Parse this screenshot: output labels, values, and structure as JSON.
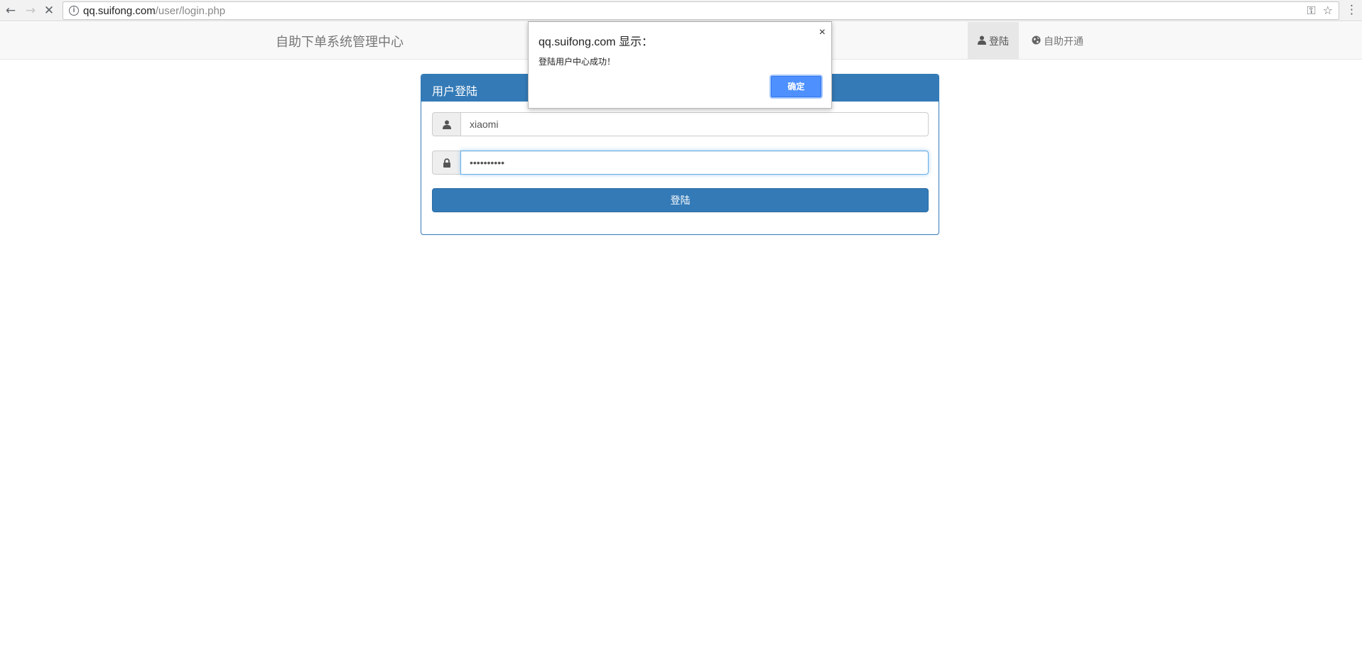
{
  "browser": {
    "url_host": "qq.suifong.com",
    "url_path": "/user/login.php",
    "back_icon": "←",
    "forward_icon": "→",
    "stop_icon": "✕",
    "info_icon": "i",
    "key_icon": "⚿",
    "star_icon": "☆",
    "menu_icon": "⋮"
  },
  "navbar": {
    "brand": "自助下单系统管理中心",
    "items": [
      {
        "label": "登陆",
        "icon": "user-icon",
        "active": true
      },
      {
        "label": "自助开通",
        "icon": "globe-icon",
        "active": false
      }
    ]
  },
  "login_panel": {
    "title": "用户登陆",
    "username_value": "xiaomi",
    "password_value": "••••••••••",
    "submit_label": "登陆"
  },
  "alert": {
    "title": "qq.suifong.com 显示：",
    "message": "登陆用户中心成功！",
    "ok_label": "确定",
    "close_icon": "×"
  },
  "colors": {
    "primary": "#337ab7",
    "dialog_button": "#4d90fe"
  }
}
